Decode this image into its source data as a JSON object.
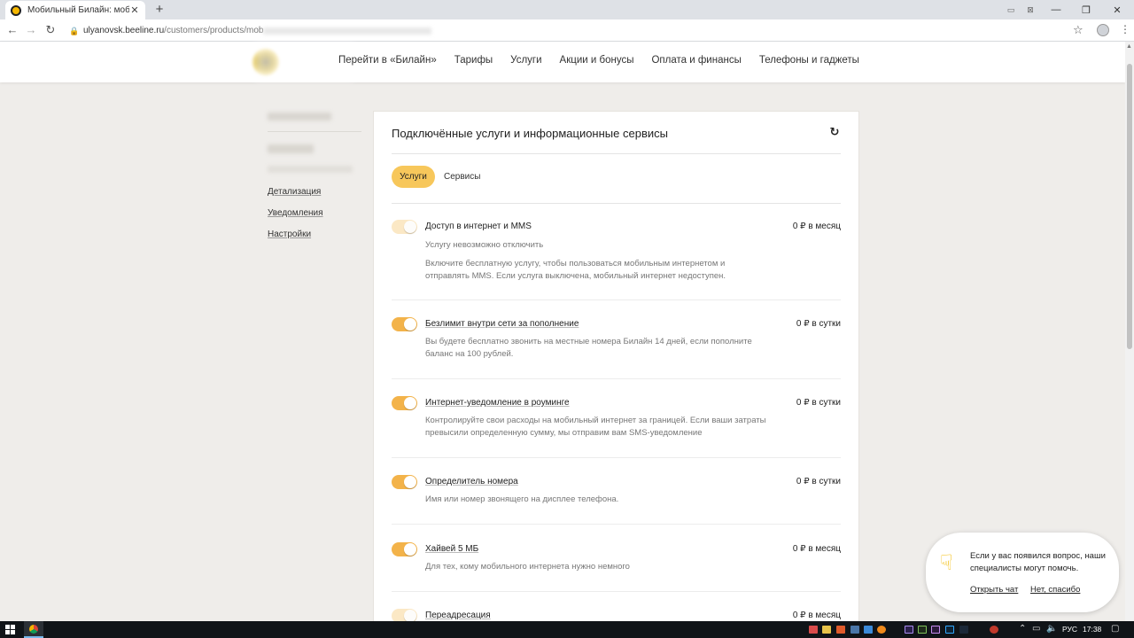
{
  "browser": {
    "tab_title": "Мобильный Билайн: мобильная",
    "url_host": "ulyanovsk.beeline.ru",
    "url_path": "/customers/products/mob"
  },
  "header": {
    "nav": [
      "Перейти в «Билайн»",
      "Тарифы",
      "Услуги",
      "Акции и бонусы",
      "Оплата и финансы",
      "Телефоны и гаджеты"
    ]
  },
  "sidebar": {
    "links": [
      "Детализация",
      "Уведомления",
      "Настройки"
    ]
  },
  "main": {
    "title": "Подключённые услуги и информационные сервисы",
    "tabs": {
      "services": "Услуги",
      "info": "Сервисы"
    },
    "services": [
      {
        "name": "Доступ в интернет и MMS",
        "price": "0 ₽ в месяц",
        "note": "Услугу невозможно отключить",
        "description": "Включите бесплатную услугу, чтобы пользоваться мобильным интернетом и отправлять MMS. Если услуга выключена, мобильный интернет недоступен.",
        "enabled": true,
        "locked": true
      },
      {
        "name": "Безлимит внутри сети за пополнение",
        "price": "0 ₽ в сутки",
        "description": "Вы будете бесплатно звонить на местные номера Билайн 14 дней, если пополните баланс на 100 рублей.",
        "enabled": true,
        "locked": false
      },
      {
        "name": "Интернет-уведомление в роуминге",
        "price": "0 ₽ в сутки",
        "description": "Контролируйте свои расходы на мобильный интернет за границей. Если ваши затраты превысили определенную сумму, мы отправим вам SMS-уведомление",
        "enabled": true,
        "locked": false
      },
      {
        "name": "Определитель номера",
        "price": "0 ₽ в сутки",
        "description": "Имя или номер звонящего на дисплее телефона.",
        "enabled": true,
        "locked": false
      },
      {
        "name": "Хайвей 5 МБ",
        "price": "0 ₽ в месяц",
        "description": "Для тех, кому мобильного интернета нужно немного",
        "enabled": true,
        "locked": false
      },
      {
        "name": "Переадресация",
        "price": "0 ₽ в месяц",
        "enabled": true,
        "locked": true
      }
    ]
  },
  "chat": {
    "text": "Если у вас появился вопрос, наши специалисты могут помочь.",
    "open_label": "Открыть чат",
    "decline_label": "Нет, спасибо"
  },
  "taskbar": {
    "lang": "РУС",
    "time": "17:38"
  },
  "colors": {
    "accent": "#f3b34a",
    "pill": "#f7c75b",
    "page_bg": "#efedea"
  }
}
